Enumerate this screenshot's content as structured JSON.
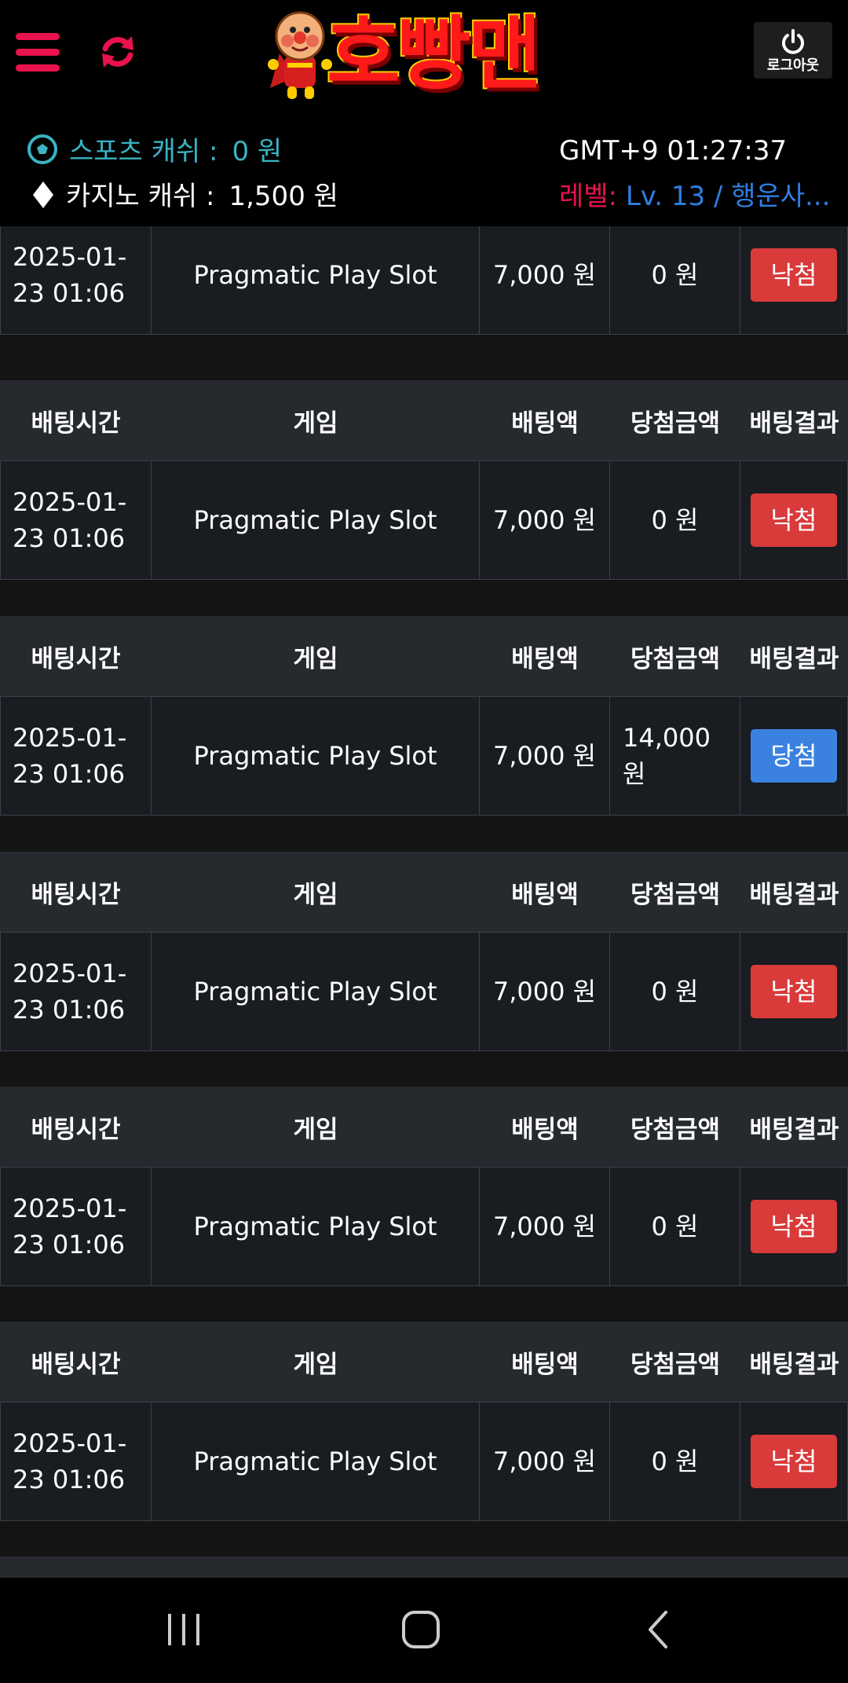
{
  "header": {
    "logo_text": "호빵맨",
    "logout_label": "로그아웃"
  },
  "info": {
    "sports_label": "스포츠 캐쉬 :",
    "sports_value": "0 원",
    "casino_label": "카지노 캐쉬 :",
    "casino_value": "1,500 원",
    "clock": "GMT+9 01:27:37",
    "level_label": "레벨:",
    "level_value": "Lv. 13 / 행운사..."
  },
  "columns": [
    "배팅시간",
    "게임",
    "배팅액",
    "당첨금액",
    "배팅결과"
  ],
  "bets": [
    {
      "time": "2025-01-\n23 01:06",
      "game": "Pragmatic Play Slot",
      "amount": "7,000 원",
      "win": "0 원",
      "result": "낙첨",
      "status": "lose"
    },
    {
      "time": "2025-01-\n23 01:06",
      "game": "Pragmatic Play Slot",
      "amount": "7,000 원",
      "win": "0 원",
      "result": "낙첨",
      "status": "lose"
    },
    {
      "time": "2025-01-\n23 01:06",
      "game": "Pragmatic Play Slot",
      "amount": "7,000 원",
      "win": "14,000\n원",
      "result": "당첨",
      "status": "win"
    },
    {
      "time": "2025-01-\n23 01:06",
      "game": "Pragmatic Play Slot",
      "amount": "7,000 원",
      "win": "0 원",
      "result": "낙첨",
      "status": "lose"
    },
    {
      "time": "2025-01-\n23 01:06",
      "game": "Pragmatic Play Slot",
      "amount": "7,000 원",
      "win": "0 원",
      "result": "낙첨",
      "status": "lose"
    },
    {
      "time": "2025-01-\n23 01:06",
      "game": "Pragmatic Play Slot",
      "amount": "7,000 원",
      "win": "0 원",
      "result": "낙첨",
      "status": "lose"
    }
  ],
  "colors": {
    "accent": "#e8124c",
    "sports_text": "#3ab3c3",
    "level_value": "#2f7fe0",
    "lose_badge": "#d93a3a",
    "win_badge": "#3b82e0"
  }
}
